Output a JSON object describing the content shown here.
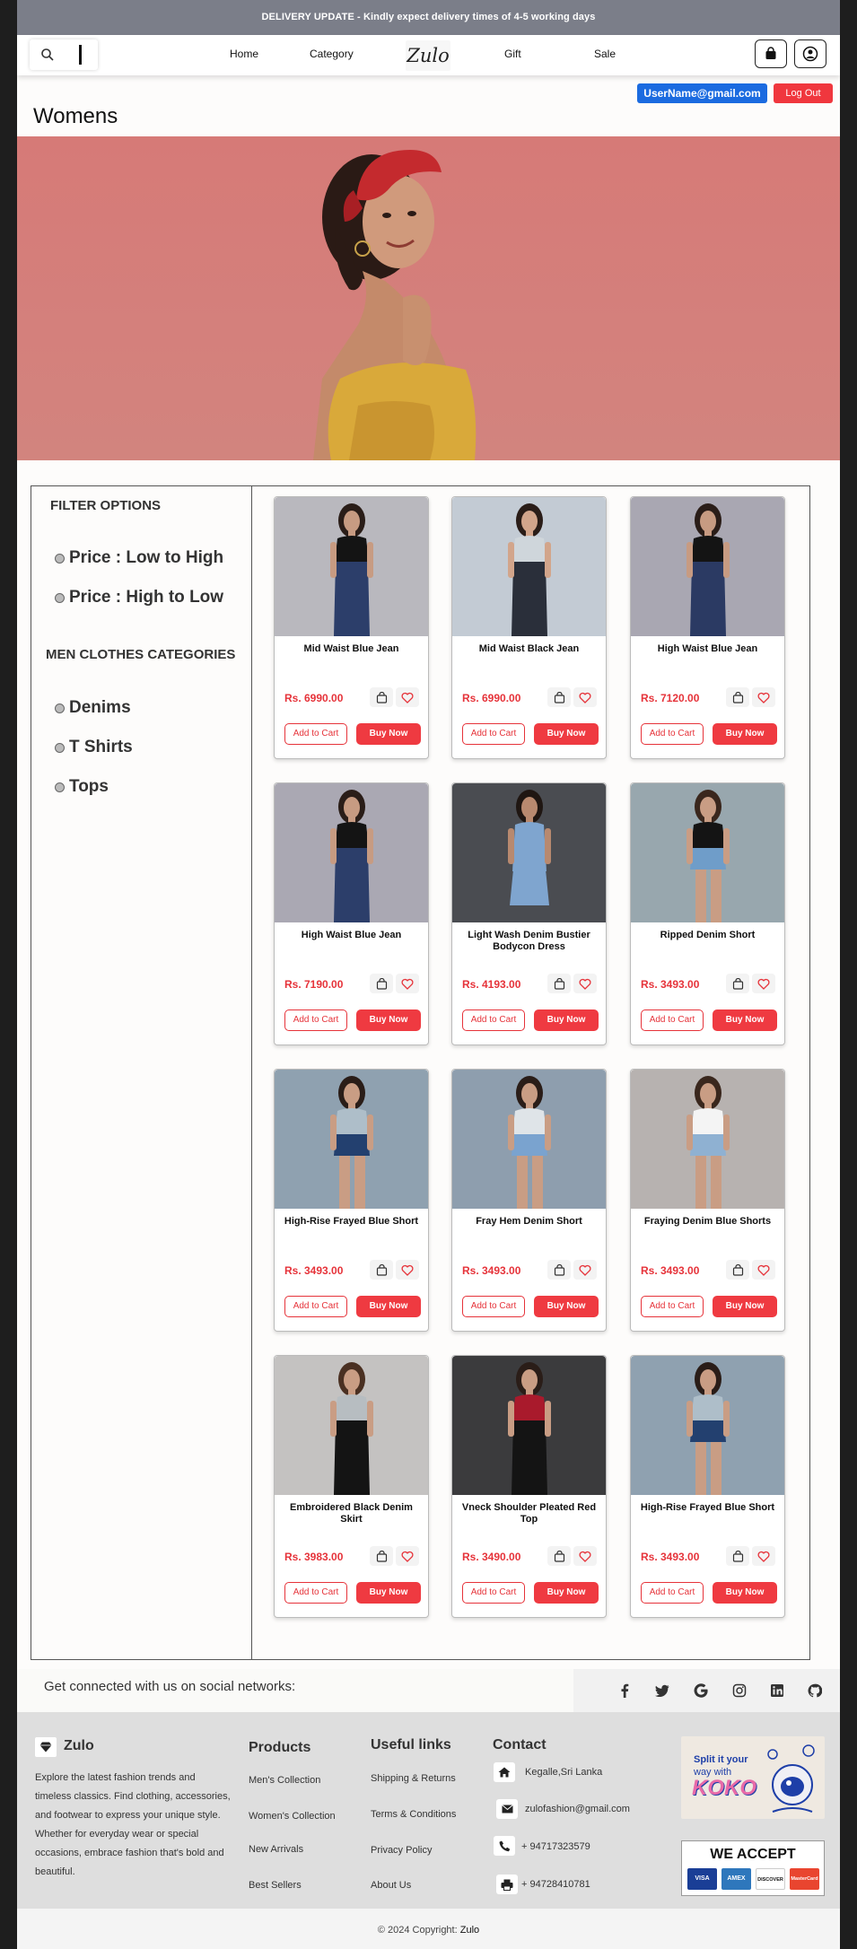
{
  "delivery_bar": {
    "text": "DELIVERY UPDATE - Kindly expect delivery times of 4-5 working days"
  },
  "nav": {
    "links": [
      "Home",
      "Category",
      "Gift",
      "Sale"
    ],
    "logo_text": "Zulo",
    "search_icon": "search-icon",
    "cart_icon": "shopping-bag-icon",
    "account_icon": "user-circle-icon"
  },
  "user": {
    "email": "UserName@gmail.com",
    "logout_label": "Log Out"
  },
  "page": {
    "title": "Womens"
  },
  "filters": {
    "title": "FILTER OPTIONS",
    "options": [
      "Price : Low to High",
      "Price : High to Low"
    ],
    "categories_title": "MEN CLOTHES CATEGORIES",
    "categories": [
      "Denims",
      "T Shirts",
      "Tops"
    ]
  },
  "product_buttons": {
    "add_to_cart": "Add to Cart",
    "buy_now": "Buy Now"
  },
  "products": [
    {
      "name": "Mid Waist Blue Jean",
      "price": "Rs. 6990.00",
      "shirt": "#141414",
      "bottom": "#2c3e6a",
      "bg": "#b9b8be",
      "skin": "#c79b82",
      "hair": "#2a1d18"
    },
    {
      "name": "Mid Waist Black Jean",
      "price": "Rs. 6990.00",
      "shirt": "#cfd6db",
      "bottom": "#2a2f3a",
      "bg": "#c3cbd4",
      "skin": "#d2a58b",
      "hair": "#2a1d18"
    },
    {
      "name": "High Waist Blue Jean",
      "price": "Rs. 7120.00",
      "shirt": "#141414",
      "bottom": "#2b3a63",
      "bg": "#a9a7b2",
      "skin": "#c79b82",
      "hair": "#2a1d18"
    },
    {
      "name": "High Waist Blue Jean",
      "price": "Rs. 7190.00",
      "shirt": "#141414",
      "bottom": "#2c3e6a",
      "bg": "#aaa8b3",
      "skin": "#c79b82",
      "hair": "#2a1d18"
    },
    {
      "name": "Light Wash Denim Bustier Bodycon Dress",
      "price": "Rs. 4193.00",
      "shirt": "#7fa5cf",
      "bottom": "#7fa5cf",
      "bg": "#4a4c51",
      "skin": "#b8896f",
      "hair": "#1f1612"
    },
    {
      "name": "Ripped Denim Short",
      "price": "Rs. 3493.00",
      "shirt": "#141414",
      "bottom": "#6f9dc9",
      "bg": "#98a7ae",
      "skin": "#c99d84",
      "hair": "#3a271d"
    },
    {
      "name": "High-Rise Frayed Blue Short",
      "price": "Rs. 3493.00",
      "shirt": "#aebec9",
      "bottom": "#23406f",
      "bg": "#8fa1b0",
      "skin": "#c99d84",
      "hair": "#2a1d18"
    },
    {
      "name": "Fray Hem Denim Short",
      "price": "Rs. 3493.00",
      "shirt": "#dfe4e8",
      "bottom": "#7aa3cf",
      "bg": "#8e9eae",
      "skin": "#c99d84",
      "hair": "#2a1d18"
    },
    {
      "name": "Fraying Denim Blue Shorts",
      "price": "Rs. 3493.00",
      "shirt": "#f4f4f4",
      "bottom": "#8fb1d2",
      "bg": "#b7b2b0",
      "skin": "#c99d84",
      "hair": "#3a271d"
    },
    {
      "name": "Embroidered Black Denim Skirt",
      "price": "Rs. 3983.00",
      "shirt": "#b7bdc1",
      "bottom": "#141414",
      "bg": "#c4c2c1",
      "skin": "#c99d84",
      "hair": "#4a3022"
    },
    {
      "name": "Vneck Shoulder Pleated Red Top",
      "price": "Rs. 3490.00",
      "shirt": "#a91a2c",
      "bottom": "#141414",
      "bg": "#3b3b3d",
      "skin": "#c99d84",
      "hair": "#2a1d18"
    },
    {
      "name": "High-Rise Frayed Blue Short",
      "price": "Rs. 3493.00",
      "shirt": "#aebec9",
      "bottom": "#23406f",
      "bg": "#8fa1b0",
      "skin": "#c99d84",
      "hair": "#2a1d18"
    }
  ],
  "social": {
    "text": "Get connected with us on social networks:",
    "icons": [
      "facebook-icon",
      "twitter-icon",
      "google-icon",
      "instagram-icon",
      "linkedin-icon",
      "github-icon"
    ]
  },
  "footer": {
    "brand": "Zulo",
    "description": "Explore the latest fashion trends and timeless classics. Find clothing, accessories, and footwear to express your unique style. Whether for everyday wear or special occasions, embrace fashion that's bold and beautiful.",
    "products_title": "Products",
    "products": [
      "Men's Collection",
      "Women's Collection",
      "New Arrivals",
      "Best Sellers"
    ],
    "useful_title": "Useful links",
    "useful": [
      "Shipping & Returns",
      "Terms & Conditions",
      "Privacy Policy",
      "About Us"
    ],
    "contact_title": "Contact",
    "contact": [
      "Kegalle,Sri Lanka",
      "zulofashion@gmail.com",
      "+ 94717323579",
      "+ 94728410781"
    ],
    "koko_line1": "Split it your",
    "koko_line2": "way with",
    "koko_brand": "KOKO",
    "accept_title": "WE ACCEPT",
    "cards": [
      "VISA",
      "AMEX",
      "DISCOVER",
      "MasterCard"
    ],
    "copyright_prefix": "© 2024 Copyright:",
    "copyright_brand": "Zulo"
  },
  "colors": {
    "accent_red": "#ef3a41",
    "link_blue": "#1b6be0",
    "header_grey": "#7b7e89",
    "hero_pink": "#d67a77"
  }
}
